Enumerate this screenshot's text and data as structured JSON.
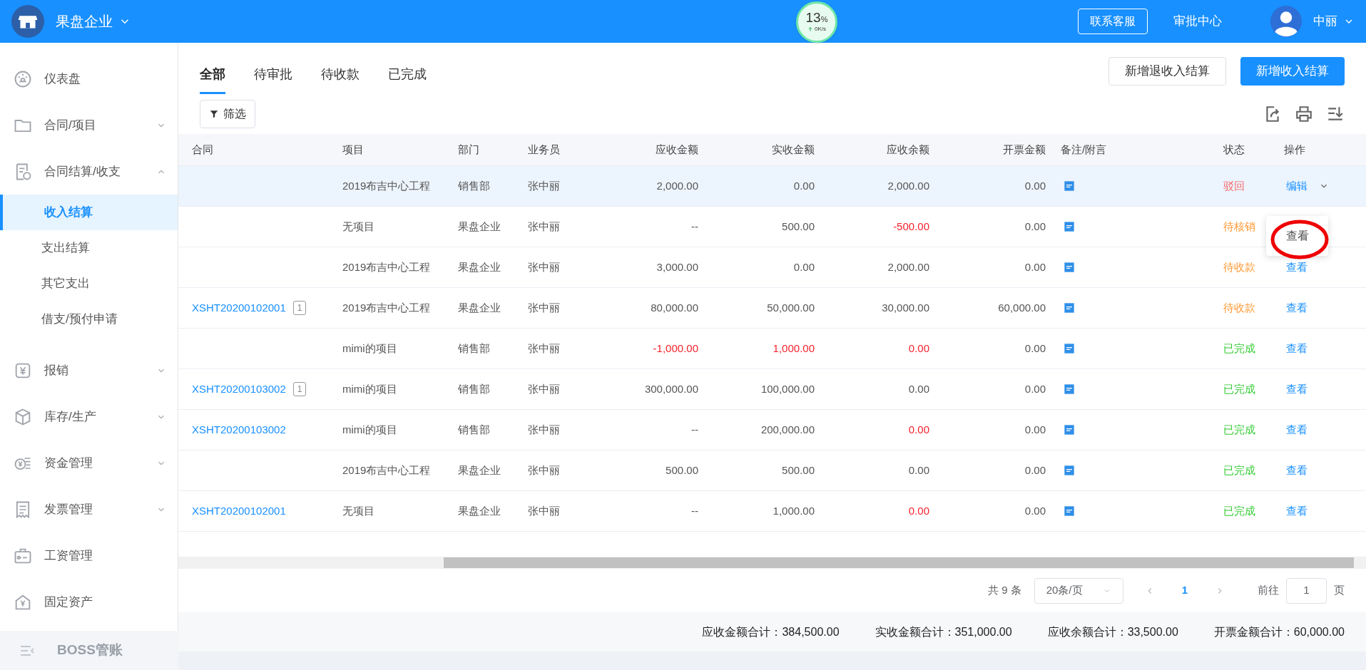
{
  "header": {
    "company": "果盘企业",
    "meter": {
      "percent": "13",
      "unit": "%",
      "speed": "0K/s"
    },
    "service_button": "联系客服",
    "approval_link": "审批中心",
    "user": "中丽"
  },
  "sidebar": {
    "items": [
      {
        "label": "仪表盘"
      },
      {
        "label": "合同/项目",
        "expanded": false
      },
      {
        "label": "合同结算/收支",
        "expanded": true,
        "children": [
          {
            "label": "收入结算",
            "selected": true
          },
          {
            "label": "支出结算",
            "selected": false
          },
          {
            "label": "其它支出",
            "selected": false
          },
          {
            "label": "借支/预付申请",
            "selected": false
          }
        ]
      },
      {
        "label": "报销",
        "expanded": false
      },
      {
        "label": "库存/生产",
        "expanded": false
      },
      {
        "label": "资金管理",
        "expanded": false
      },
      {
        "label": "发票管理",
        "expanded": false
      },
      {
        "label": "工资管理"
      },
      {
        "label": "固定资产"
      }
    ],
    "footer": "BOSS管账"
  },
  "tabs": [
    {
      "label": "全部",
      "selected": true
    },
    {
      "label": "待审批",
      "selected": false
    },
    {
      "label": "待收款",
      "selected": false
    },
    {
      "label": "已完成",
      "selected": false
    }
  ],
  "buttons": {
    "refund": "新增退收入结算",
    "add": "新增收入结算",
    "filter": "筛选"
  },
  "table": {
    "columns": [
      "合同",
      "项目",
      "部门",
      "业务员",
      "应收金额",
      "实收金额",
      "应收余额",
      "开票金额",
      "备注/附言",
      "状态",
      "操作"
    ],
    "rows": [
      {
        "highlighted": true,
        "contract": "",
        "badge": "",
        "project": "2019布吉中心工程",
        "dept": "销售部",
        "staff": "张中丽",
        "amounts": [
          {
            "text": "2,000.00",
            "red": false
          },
          {
            "text": "0.00",
            "red": false
          },
          {
            "text": "2,000.00",
            "red": false
          },
          {
            "text": "0.00",
            "red": false
          }
        ],
        "status": {
          "text": "驳回",
          "color": "#f56c6c"
        },
        "action": {
          "text": "编辑",
          "dropdown": true
        }
      },
      {
        "highlighted": false,
        "contract": "",
        "badge": "",
        "project": "无项目",
        "dept": "果盘企业",
        "staff": "张中丽",
        "amounts": [
          {
            "text": "--",
            "red": false
          },
          {
            "text": "500.00",
            "red": false
          },
          {
            "text": "-500.00",
            "red": true
          },
          {
            "text": "0.00",
            "red": false
          }
        ],
        "status": {
          "text": "待核销",
          "color": "#ff9933"
        }
      },
      {
        "highlighted": false,
        "contract": "",
        "badge": "",
        "project": "2019布吉中心工程",
        "dept": "果盘企业",
        "staff": "张中丽",
        "amounts": [
          {
            "text": "3,000.00",
            "red": false
          },
          {
            "text": "0.00",
            "red": false
          },
          {
            "text": "2,000.00",
            "red": false
          },
          {
            "text": "0.00",
            "red": false
          }
        ],
        "status": {
          "text": "待收款",
          "color": "#ff9933"
        },
        "action": {
          "text": "查看"
        }
      },
      {
        "highlighted": false,
        "contract": "XSHT20200102001",
        "badge": "1",
        "project": "2019布吉中心工程",
        "dept": "果盘企业",
        "staff": "张中丽",
        "amounts": [
          {
            "text": "80,000.00",
            "red": false
          },
          {
            "text": "50,000.00",
            "red": false
          },
          {
            "text": "30,000.00",
            "red": false
          },
          {
            "text": "60,000.00",
            "red": false
          }
        ],
        "status": {
          "text": "待收款",
          "color": "#ff9933"
        },
        "action": {
          "text": "查看"
        }
      },
      {
        "highlighted": false,
        "contract": "",
        "badge": "",
        "project": "mimi的项目",
        "dept": "销售部",
        "staff": "张中丽",
        "amounts": [
          {
            "text": "-1,000.00",
            "red": true
          },
          {
            "text": "1,000.00",
            "red": true
          },
          {
            "text": "0.00",
            "red": true
          },
          {
            "text": "0.00",
            "red": false
          }
        ],
        "status": {
          "text": "已完成",
          "color": "#33cc33"
        },
        "action": {
          "text": "查看"
        }
      },
      {
        "highlighted": false,
        "contract": "XSHT20200103002",
        "badge": "1",
        "project": "mimi的项目",
        "dept": "销售部",
        "staff": "张中丽",
        "amounts": [
          {
            "text": "300,000.00",
            "red": false
          },
          {
            "text": "100,000.00",
            "red": false
          },
          {
            "text": "0.00",
            "red": false
          },
          {
            "text": "0.00",
            "red": false
          }
        ],
        "status": {
          "text": "已完成",
          "color": "#33cc33"
        },
        "action": {
          "text": "查看"
        }
      },
      {
        "highlighted": false,
        "contract": "XSHT20200103002",
        "badge": "",
        "project": "mimi的项目",
        "dept": "销售部",
        "staff": "张中丽",
        "amounts": [
          {
            "text": "--",
            "red": false
          },
          {
            "text": "200,000.00",
            "red": false
          },
          {
            "text": "0.00",
            "red": true
          },
          {
            "text": "0.00",
            "red": false
          }
        ],
        "status": {
          "text": "已完成",
          "color": "#33cc33"
        },
        "action": {
          "text": "查看"
        }
      },
      {
        "highlighted": false,
        "contract": "",
        "badge": "",
        "project": "2019布吉中心工程",
        "dept": "果盘企业",
        "staff": "张中丽",
        "amounts": [
          {
            "text": "500.00",
            "red": false
          },
          {
            "text": "500.00",
            "red": false
          },
          {
            "text": "0.00",
            "red": false
          },
          {
            "text": "0.00",
            "red": false
          }
        ],
        "status": {
          "text": "已完成",
          "color": "#33cc33"
        },
        "action": {
          "text": "查看"
        }
      },
      {
        "highlighted": false,
        "contract": "XSHT20200102001",
        "badge": "",
        "project": "无项目",
        "dept": "果盘企业",
        "staff": "张中丽",
        "amounts": [
          {
            "text": "--",
            "red": false
          },
          {
            "text": "1,000.00",
            "red": false
          },
          {
            "text": "0.00",
            "red": true
          },
          {
            "text": "0.00",
            "red": false
          }
        ],
        "status": {
          "text": "已完成",
          "color": "#33cc33"
        },
        "action": {
          "text": "查看"
        }
      }
    ]
  },
  "dropdown": {
    "items": [
      "查看"
    ],
    "circled": true
  },
  "pagination": {
    "total": "共 9 条",
    "page_size": "20条/页",
    "current": "1",
    "goto_label": "前往",
    "goto_value": "1",
    "page_suffix": "页"
  },
  "totals": [
    "应收金额合计：384,500.00",
    "实收金额合计：351,000.00",
    "应收余额合计：33,500.00",
    "开票金额合计：60,000.00"
  ]
}
